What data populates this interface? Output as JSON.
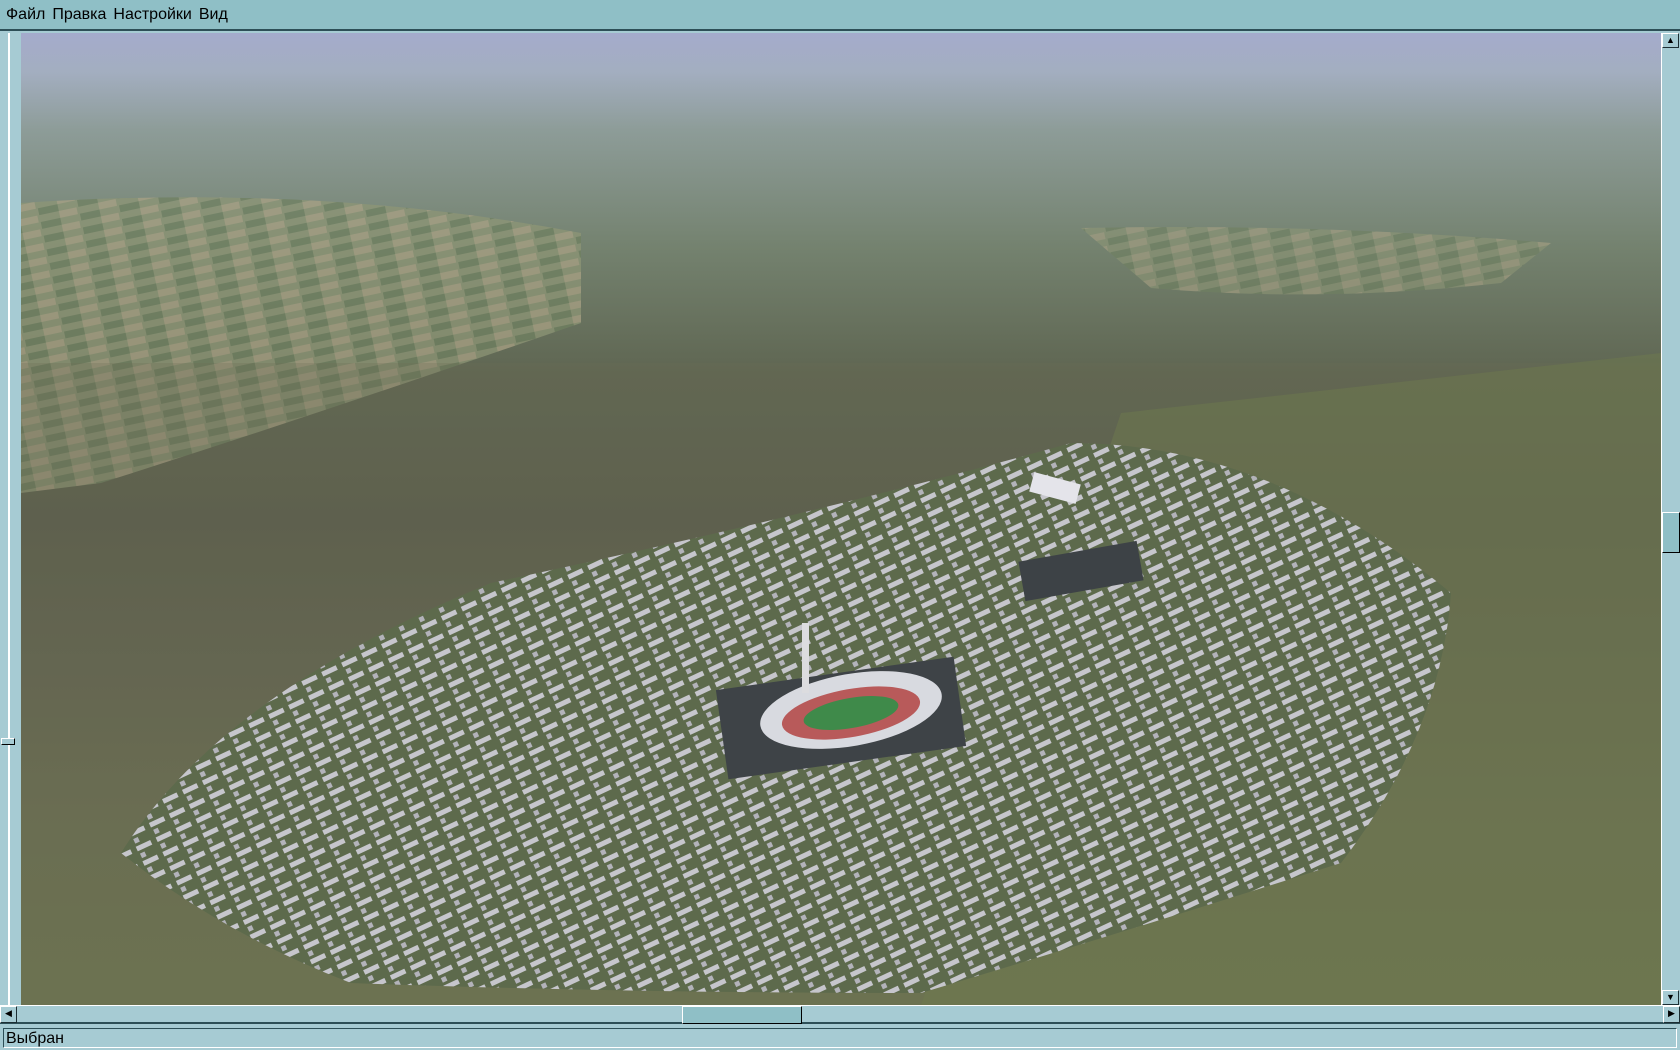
{
  "menu": {
    "items": [
      "Файл",
      "Правка",
      "Настройки",
      "Вид"
    ]
  },
  "scrollbars": {
    "up_icon": "triangle-up",
    "down_icon": "triangle-down",
    "left_icon": "triangle-left",
    "right_icon": "triangle-right",
    "vertical_position": 0.5,
    "horizontal_position": 0.43
  },
  "status": {
    "text": "Выбран"
  },
  "scene": {
    "description_colors": {
      "sky": "#a4abcc",
      "terrain": "#5f6652",
      "city": "#c9c9cf",
      "stadium_track": "#b85a5a",
      "field": "#3f8a4a"
    }
  }
}
